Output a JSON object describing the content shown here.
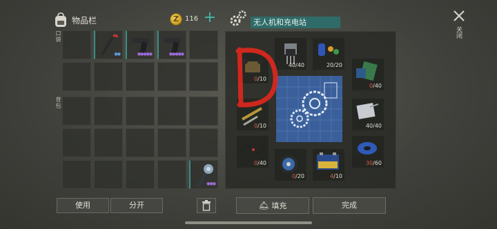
{
  "inventory": {
    "title": "物品栏",
    "coins": "116",
    "pocket_label": "口袋",
    "backpack_label": "背包",
    "buttons": {
      "use": "使用",
      "split": "分开"
    }
  },
  "crafting": {
    "title": "无人机和充电站",
    "ingredients": [
      {
        "name": "drone-frame",
        "have": "0",
        "need": "/10"
      },
      {
        "name": "transistor",
        "have": "40",
        "need": "/40"
      },
      {
        "name": "capacitors",
        "have": "20",
        "need": "/20"
      },
      {
        "name": "circuit-boards",
        "have": "0",
        "need": "/40"
      },
      {
        "name": "screws-bolts",
        "have": "0",
        "need": "/10"
      },
      {
        "name": "metal-parts",
        "have": "40",
        "need": "/40"
      },
      {
        "name": "wires",
        "have": "0",
        "need": "/40"
      },
      {
        "name": "wire-spool",
        "have": "0",
        "need": "/20"
      },
      {
        "name": "battery",
        "have": "4",
        "need": "/10"
      },
      {
        "name": "tape",
        "have": "30",
        "need": "/60"
      }
    ],
    "buttons": {
      "fill": "填充",
      "done": "完成"
    }
  },
  "close_label": "关闭",
  "colors": {
    "accent": "#3a8d86",
    "deficit": "#e05a4a",
    "rare": "#9a6bd6"
  }
}
